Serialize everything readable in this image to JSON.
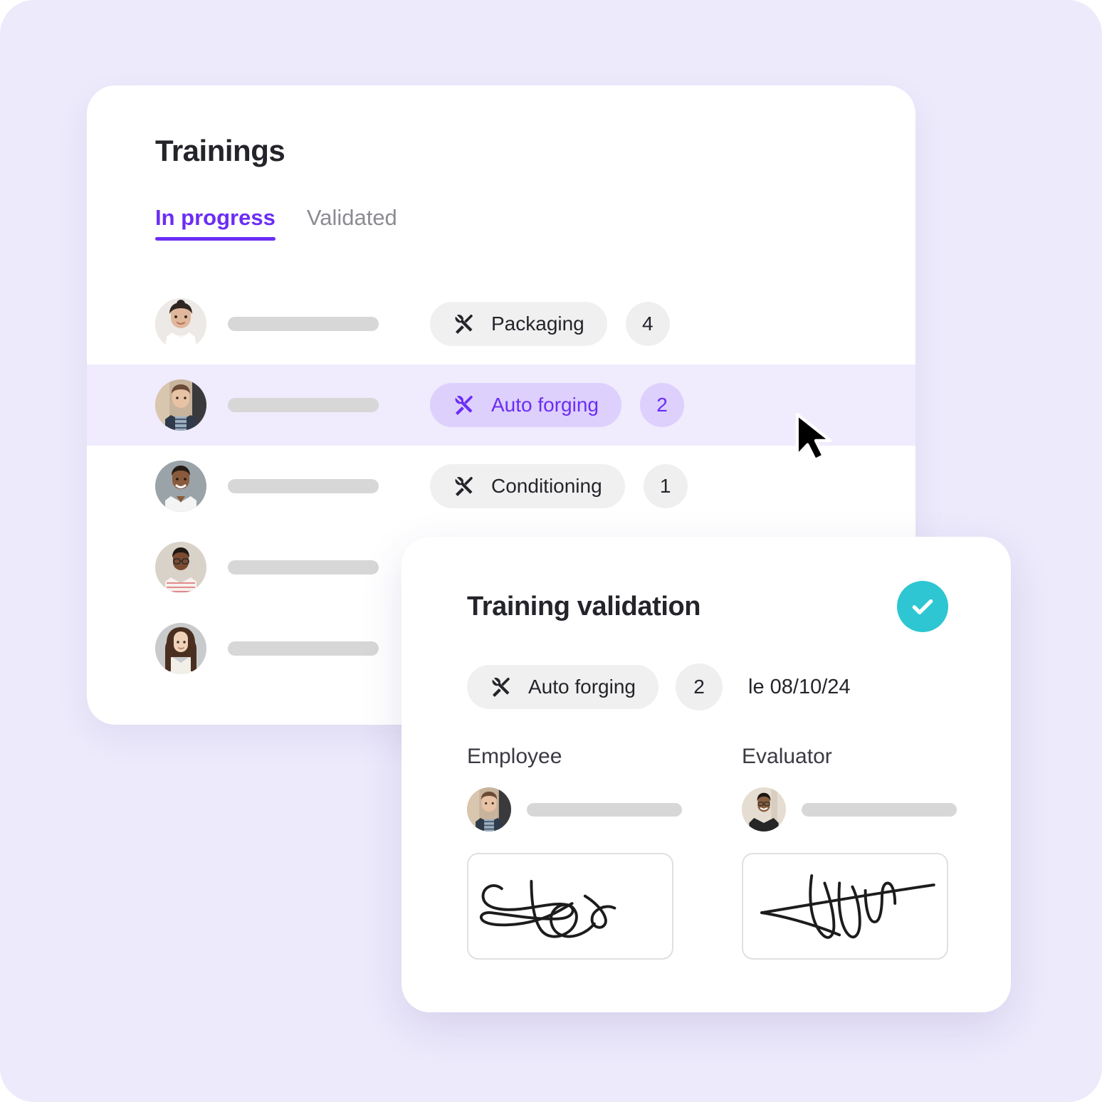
{
  "theme": {
    "background": "#edeafc",
    "card": "#ffffff",
    "accent_purple": "#6b2df5",
    "accent_purple_soft": "#ddd0fd",
    "row_selected": "#f0ebfd",
    "chip_grey": "#f0f0f0",
    "placeholder_grey": "#d7d7d7",
    "teal": "#2ec6d2",
    "text_dark": "#24242b",
    "text_muted": "#8b8b93"
  },
  "trainings": {
    "title": "Trainings",
    "tabs": [
      {
        "label": "In progress",
        "active": true
      },
      {
        "label": "Validated",
        "active": false
      }
    ],
    "rows": [
      {
        "avatar": "avatar-woman-bun",
        "name_placeholder": true,
        "chip_label": "Packaging",
        "chip_icon": "tools-icon",
        "count": "4",
        "selected": false,
        "has_chip": true
      },
      {
        "avatar": "avatar-man-striped-shirt",
        "name_placeholder": true,
        "chip_label": "Auto forging",
        "chip_icon": "tools-icon",
        "count": "2",
        "selected": true,
        "has_chip": true
      },
      {
        "avatar": "avatar-man-white-tee",
        "name_placeholder": true,
        "chip_label": "Conditioning",
        "chip_icon": "tools-icon",
        "count": "1",
        "selected": false,
        "has_chip": true
      },
      {
        "avatar": "avatar-man-glasses-stripes",
        "name_placeholder": true,
        "chip_label": "",
        "chip_icon": "",
        "count": "",
        "selected": false,
        "has_chip": false
      },
      {
        "avatar": "avatar-woman-long-hair",
        "name_placeholder": true,
        "chip_label": "",
        "chip_icon": "",
        "count": "",
        "selected": false,
        "has_chip": false
      }
    ]
  },
  "validation": {
    "title": "Training validation",
    "status_icon": "check-icon",
    "chip_label": "Auto forging",
    "chip_icon": "tools-icon",
    "count": "2",
    "date": "le 08/10/24",
    "columns": [
      {
        "label": "Employee",
        "avatar": "avatar-man-striped-shirt",
        "name_placeholder": true,
        "signature": "signature-scribble-loops"
      },
      {
        "label": "Evaluator",
        "avatar": "avatar-man-black-tee",
        "name_placeholder": true,
        "signature": "signature-scribble-peaks"
      }
    ]
  },
  "cursor": {
    "icon": "arrow-pointer-icon"
  }
}
